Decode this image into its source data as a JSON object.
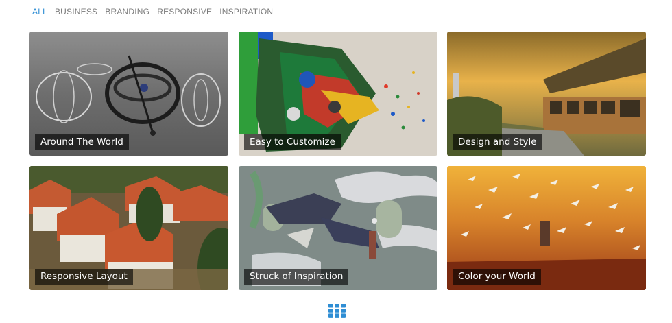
{
  "filters": [
    {
      "label": "ALL",
      "active": true
    },
    {
      "label": "BUSINESS",
      "active": false
    },
    {
      "label": "BRANDING",
      "active": false
    },
    {
      "label": "RESPONSIVE",
      "active": false
    },
    {
      "label": "INSPIRATION",
      "active": false
    }
  ],
  "portfolio": {
    "items": [
      {
        "title": "Around The World"
      },
      {
        "title": "Easy to Customize"
      },
      {
        "title": "Design and Style"
      },
      {
        "title": "Responsive Layout"
      },
      {
        "title": "Struck of Inspiration"
      },
      {
        "title": "Color your World"
      }
    ]
  },
  "icons": {
    "more": "grid-icon"
  },
  "colors": {
    "accent": "#2f8ed4",
    "filter_text": "#7a7a7a",
    "label_bg": "rgba(0,0,0,0.62)"
  }
}
